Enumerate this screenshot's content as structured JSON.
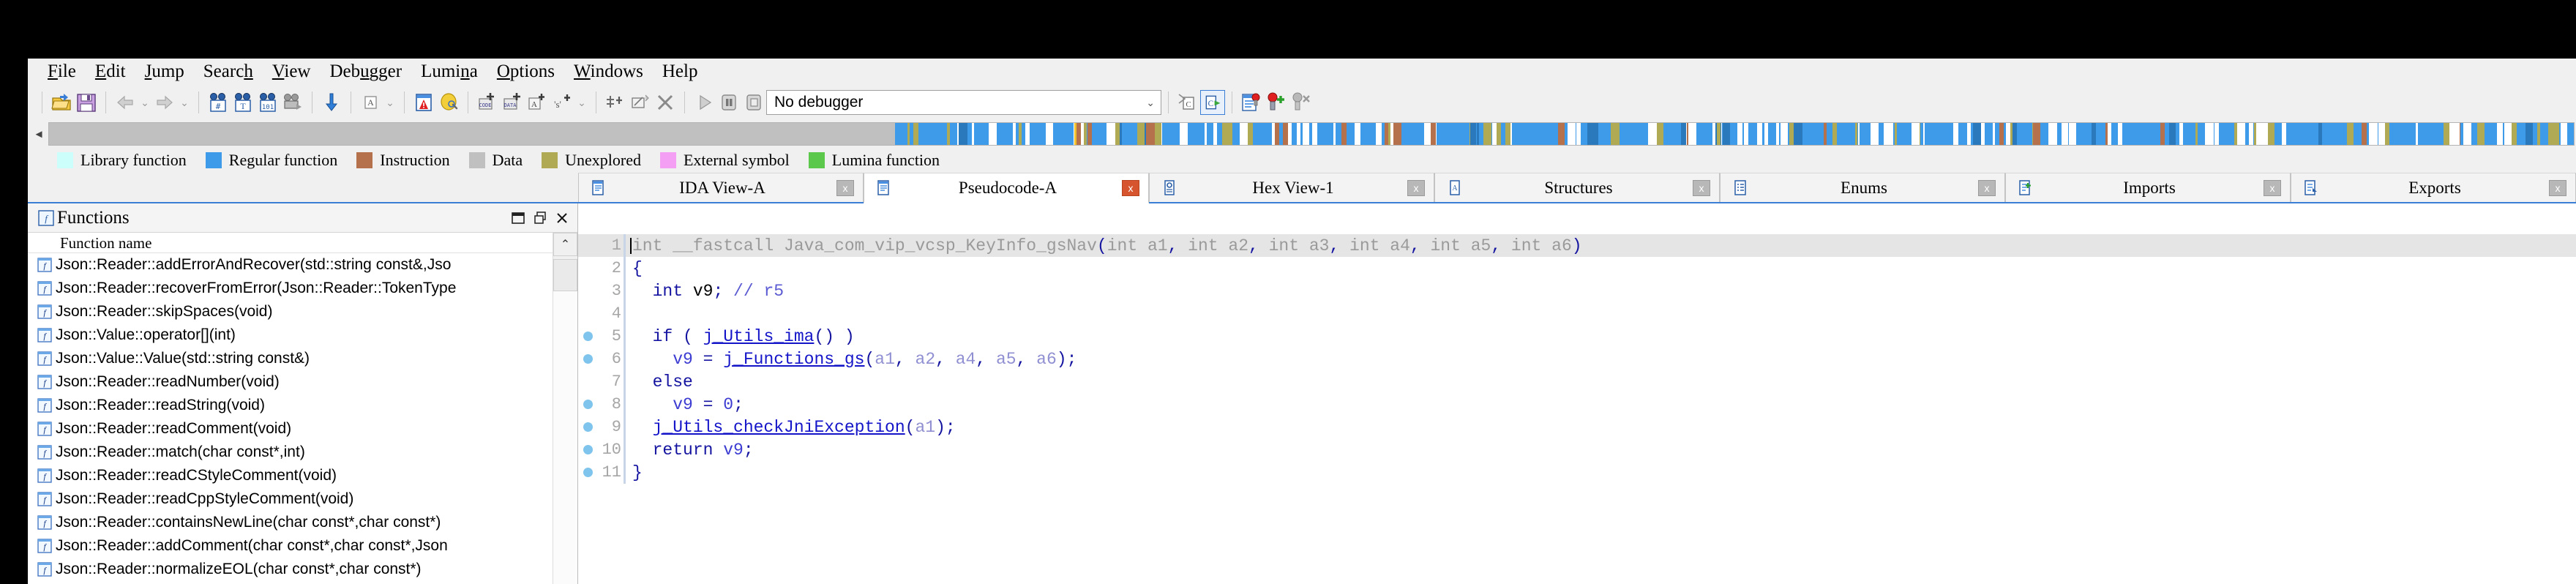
{
  "menu": {
    "items": [
      {
        "label": "File",
        "mnemonic": "F"
      },
      {
        "label": "Edit",
        "mnemonic": "E"
      },
      {
        "label": "Jump",
        "mnemonic": "J"
      },
      {
        "label": "Search",
        "mnemonic": "h"
      },
      {
        "label": "View",
        "mnemonic": "V"
      },
      {
        "label": "Debugger",
        "mnemonic": "u"
      },
      {
        "label": "Lumina",
        "mnemonic": "n"
      },
      {
        "label": "Options",
        "mnemonic": "O"
      },
      {
        "label": "Windows",
        "mnemonic": "W"
      },
      {
        "label": "Help",
        "mnemonic": ""
      }
    ]
  },
  "toolbar": {
    "debugger_select": "No debugger",
    "icons": [
      "open-file-icon",
      "save-icon",
      "navigate-back-icon",
      "navigate-forward-icon",
      "search-hash-icon",
      "search-text-icon",
      "search-binary-icon",
      "search-next-icon",
      "jump-down-icon",
      "ascii-icon",
      "alert-icon",
      "lumina-icon",
      "make-code-icon",
      "make-data-icon",
      "make-ascii-icon",
      "make-struct-icon",
      "make-array-icon",
      "undefine-icon",
      "delete-icon",
      "run-icon",
      "pause-icon",
      "stop-icon",
      "step-over-source-icon",
      "step-into-source-icon",
      "breakpoint-list-icon",
      "add-breakpoint-icon",
      "disable-breakpoint-icon"
    ]
  },
  "legend": {
    "items": [
      {
        "label": "Library function",
        "color": "#ccfffb"
      },
      {
        "label": "Regular function",
        "color": "#3d9be9"
      },
      {
        "label": "Instruction",
        "color": "#b5714c"
      },
      {
        "label": "Data",
        "color": "#c0c0c0"
      },
      {
        "label": "Unexplored",
        "color": "#b0aa55"
      },
      {
        "label": "External symbol",
        "color": "#f49ff4"
      },
      {
        "label": "Lumina function",
        "color": "#5bc84c"
      }
    ]
  },
  "navigator": {
    "unexplored_color": "#c0c0c0",
    "regular_color": "#3d9be9",
    "instruction_color": "#b5714c",
    "unexplored_mark_color": "#b0aa55",
    "cursor_color": "#f2c12e"
  },
  "tabs": [
    {
      "label": "IDA View-A",
      "icon": "document-view-icon",
      "active": false,
      "close": "x"
    },
    {
      "label": "Pseudocode-A",
      "icon": "document-view-icon",
      "active": true,
      "close": "x"
    },
    {
      "label": "Hex View-1",
      "icon": "hex-view-icon",
      "active": false,
      "close": "x"
    },
    {
      "label": "Structures",
      "icon": "structures-icon",
      "active": false,
      "close": "x"
    },
    {
      "label": "Enums",
      "icon": "enums-icon",
      "active": false,
      "close": "x"
    },
    {
      "label": "Imports",
      "icon": "imports-icon",
      "active": false,
      "close": "x"
    },
    {
      "label": "Exports",
      "icon": "exports-icon",
      "active": false,
      "close": "x"
    }
  ],
  "functions_panel": {
    "title": "Functions",
    "title_icon": "function-icon",
    "window_buttons": [
      "restore-icon",
      "maximize-icon",
      "close-icon"
    ],
    "column_header": "Function name",
    "rows": [
      "Json::Reader::addErrorAndRecover(std::string const&,Jso",
      "Json::Reader::recoverFromError(Json::Reader::TokenType",
      "Json::Reader::skipSpaces(void)",
      "Json::Value::operator[](int)",
      "Json::Value::Value(std::string const&)",
      "Json::Reader::readNumber(void)",
      "Json::Reader::readString(void)",
      "Json::Reader::readComment(void)",
      "Json::Reader::match(char const*,int)",
      "Json::Reader::readCStyleComment(void)",
      "Json::Reader::readCppStyleComment(void)",
      "Json::Reader::containsNewLine(char const*,char const*)",
      "Json::Reader::addComment(char const*,char const*,Json",
      "Json::Reader::normalizeEOL(char const*,char const*)"
    ]
  },
  "pseudocode": {
    "lines": [
      {
        "num": "1",
        "breakpoint": false,
        "highlighted": true,
        "tokens": [
          {
            "t": "int ",
            "c": "k-gray"
          },
          {
            "t": "__fastcall ",
            "c": "k-gray"
          },
          {
            "t": "Java_com_vip_vcsp_KeyInfo_gsNav",
            "c": "k-gray"
          },
          {
            "t": "(",
            "c": "k-punct"
          },
          {
            "t": "int a1",
            "c": "k-gray"
          },
          {
            "t": ",",
            "c": "k-punct"
          },
          {
            "t": " int a2",
            "c": "k-gray"
          },
          {
            "t": ",",
            "c": "k-punct"
          },
          {
            "t": " int a3",
            "c": "k-gray"
          },
          {
            "t": ",",
            "c": "k-punct"
          },
          {
            "t": " int a4",
            "c": "k-gray"
          },
          {
            "t": ",",
            "c": "k-punct"
          },
          {
            "t": " int a5",
            "c": "k-gray"
          },
          {
            "t": ",",
            "c": "k-punct"
          },
          {
            "t": " int a6",
            "c": "k-gray"
          },
          {
            "t": ")",
            "c": "k-punct"
          }
        ]
      },
      {
        "num": "2",
        "breakpoint": false,
        "highlighted": false,
        "tokens": [
          {
            "t": "{",
            "c": "k-punct"
          }
        ]
      },
      {
        "num": "3",
        "breakpoint": false,
        "highlighted": false,
        "tokens": [
          {
            "t": "  int ",
            "c": "k-type"
          },
          {
            "t": "v9",
            "c": "k-plain"
          },
          {
            "t": ";",
            "c": "k-punct"
          },
          {
            "t": " // ",
            "c": "k-cmt"
          },
          {
            "t": "r5",
            "c": "k-cmt"
          }
        ]
      },
      {
        "num": "4",
        "breakpoint": false,
        "highlighted": false,
        "tokens": [
          {
            "t": "",
            "c": "k-plain"
          }
        ]
      },
      {
        "num": "5",
        "breakpoint": true,
        "highlighted": false,
        "tokens": [
          {
            "t": "  if ( ",
            "c": "k-kw"
          },
          {
            "t": "j_Utils_ima",
            "c": "k-func"
          },
          {
            "t": "() )",
            "c": "k-punct"
          }
        ]
      },
      {
        "num": "6",
        "breakpoint": true,
        "highlighted": false,
        "tokens": [
          {
            "t": "    ",
            "c": "k-plain"
          },
          {
            "t": "v9",
            "c": "k-var"
          },
          {
            "t": " = ",
            "c": "k-punct"
          },
          {
            "t": "j_Functions_gs",
            "c": "k-func"
          },
          {
            "t": "(",
            "c": "k-punct"
          },
          {
            "t": "a1",
            "c": "k-arg"
          },
          {
            "t": ", ",
            "c": "k-punct"
          },
          {
            "t": "a2",
            "c": "k-arg"
          },
          {
            "t": ", ",
            "c": "k-punct"
          },
          {
            "t": "a4",
            "c": "k-arg"
          },
          {
            "t": ", ",
            "c": "k-punct"
          },
          {
            "t": "a5",
            "c": "k-arg"
          },
          {
            "t": ", ",
            "c": "k-punct"
          },
          {
            "t": "a6",
            "c": "k-arg"
          },
          {
            "t": ");",
            "c": "k-punct"
          }
        ]
      },
      {
        "num": "7",
        "breakpoint": false,
        "highlighted": false,
        "tokens": [
          {
            "t": "  else",
            "c": "k-kw"
          }
        ]
      },
      {
        "num": "8",
        "breakpoint": true,
        "highlighted": false,
        "tokens": [
          {
            "t": "    ",
            "c": "k-plain"
          },
          {
            "t": "v9",
            "c": "k-var"
          },
          {
            "t": " = ",
            "c": "k-punct"
          },
          {
            "t": "0",
            "c": "k-num"
          },
          {
            "t": ";",
            "c": "k-punct"
          }
        ]
      },
      {
        "num": "9",
        "breakpoint": true,
        "highlighted": false,
        "tokens": [
          {
            "t": "  ",
            "c": "k-plain"
          },
          {
            "t": "j_Utils_checkJniException",
            "c": "k-func"
          },
          {
            "t": "(",
            "c": "k-punct"
          },
          {
            "t": "a1",
            "c": "k-arg"
          },
          {
            "t": ");",
            "c": "k-punct"
          }
        ]
      },
      {
        "num": "10",
        "breakpoint": true,
        "highlighted": false,
        "tokens": [
          {
            "t": "  return ",
            "c": "k-kw"
          },
          {
            "t": "v9",
            "c": "k-var"
          },
          {
            "t": ";",
            "c": "k-punct"
          }
        ]
      },
      {
        "num": "11",
        "breakpoint": true,
        "highlighted": false,
        "tokens": [
          {
            "t": "}",
            "c": "k-punct"
          }
        ]
      }
    ]
  }
}
